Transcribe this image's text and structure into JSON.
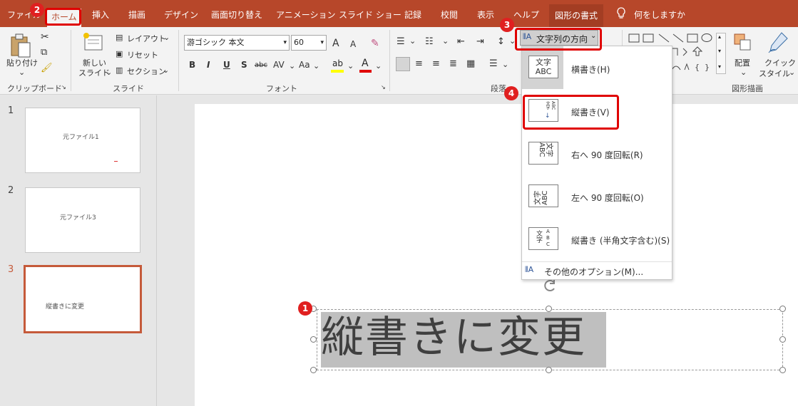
{
  "menu": {
    "tabs": [
      "ファイル",
      "ホーム",
      "挿入",
      "描画",
      "デザイン",
      "画面切り替え",
      "アニメーション",
      "スライド ショー",
      "記録",
      "校閲",
      "表示",
      "ヘルプ",
      "図形の書式"
    ],
    "tell_me": "何をしますか"
  },
  "ribbon": {
    "paste": "貼り付け",
    "clipboard_group": "クリップボード",
    "new_slide_1": "新しい",
    "new_slide_2": "スライド",
    "layout": "レイアウト",
    "reset": "リセット",
    "section": "セクション",
    "slides_group": "スライド",
    "font_name": "游ゴシック 本文",
    "font_size": "60",
    "font_group": "フォント",
    "paragraph_group": "段落",
    "text_direction": "文字列の方向",
    "arrange": "配置",
    "quick_style_1": "クイック",
    "quick_style_2": "スタイル",
    "drawing_group": "図形描画",
    "fmt": {
      "bold": "B",
      "italic": "I",
      "underline": "U",
      "shadow": "S",
      "strike": "abc",
      "spacing": "AV",
      "case": "Aa",
      "grow": "A",
      "shrink": "A"
    }
  },
  "dropdown": {
    "items": [
      {
        "label": "横書き(H)",
        "icon_text": "文字\nABC"
      },
      {
        "label": "縦書き(V)",
        "icon_text": "縦書き"
      },
      {
        "label": "右へ 90 度回転(R)",
        "icon_text": "文字ABC"
      },
      {
        "label": "左へ 90 度回転(O)",
        "icon_text": "文字ABC"
      },
      {
        "label": "縦書き (半角文字含む)(S)",
        "icon_text": "文字ABC"
      }
    ],
    "more": "その他のオプション(M)..."
  },
  "slides": [
    {
      "num": "1",
      "text": "元ファイル1"
    },
    {
      "num": "2",
      "text": "元ファイル3"
    },
    {
      "num": "3",
      "text": "縦書きに変更"
    }
  ],
  "slide_text": "縦書きに変更",
  "badges": [
    "1",
    "2",
    "3",
    "4"
  ],
  "colors": {
    "accent": "#b7472a",
    "annotation": "#e00000"
  }
}
